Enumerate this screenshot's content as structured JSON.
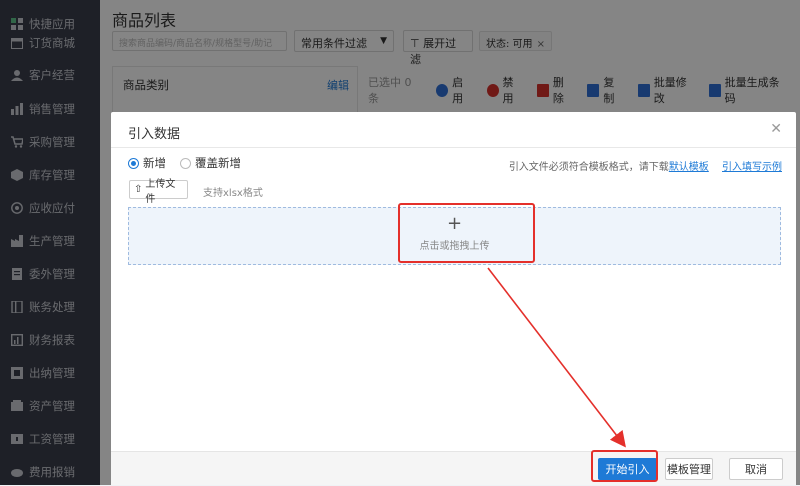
{
  "sidebar": {
    "items": [
      {
        "label": "快捷应用",
        "icon": "grid-icon"
      },
      {
        "label": "订货商城",
        "icon": "calendar-icon"
      },
      {
        "label": "客户经营",
        "icon": "user-icon"
      },
      {
        "label": "销售管理",
        "icon": "chart-icon"
      },
      {
        "label": "采购管理",
        "icon": "cart-icon"
      },
      {
        "label": "库存管理",
        "icon": "box-icon"
      },
      {
        "label": "应收应付",
        "icon": "coin-icon"
      },
      {
        "label": "生产管理",
        "icon": "factory-icon"
      },
      {
        "label": "委外管理",
        "icon": "doc-icon"
      },
      {
        "label": "账务处理",
        "icon": "book-icon"
      },
      {
        "label": "财务报表",
        "icon": "report-icon"
      },
      {
        "label": "出纳管理",
        "icon": "cashier-icon"
      },
      {
        "label": "资产管理",
        "icon": "asset-icon"
      },
      {
        "label": "工资管理",
        "icon": "wage-icon"
      },
      {
        "label": "费用报销",
        "icon": "expense-icon"
      }
    ]
  },
  "page": {
    "title": "商品列表",
    "search_placeholder": "搜索商品编码/商品名称/规格型号/助记",
    "filter_select": "常用条件过滤",
    "expand_filter": "展开过滤",
    "status_tag": "状态: 可用",
    "category_title": "商品类别",
    "category_edit": "编辑",
    "selected_count": "已选中 0 条",
    "toolbar": {
      "enable": "启用",
      "disable": "禁用",
      "delete": "删除",
      "copy": "复制",
      "batch_edit": "批量修改",
      "batch_barcode": "批量生成条码"
    },
    "colors": {
      "enable": "#2f6fd6",
      "disable": "#d6302b",
      "delete": "#d6302b",
      "copy": "#2f6fd6",
      "batch_edit": "#2f6fd6",
      "batch_barcode": "#2f6fd6"
    }
  },
  "modal": {
    "title": "引入数据",
    "radio_new": "新增",
    "radio_overwrite": "覆盖新增",
    "selected_radio": "新增",
    "hint_text": "引入文件必须符合模板格式，请下载",
    "hint_link_template": "默认模板",
    "hint_link_example": "引入填写示例",
    "upload_button": "上传文件",
    "upload_hint": "支持xlsx格式",
    "dropzone_plus": "+",
    "dropzone_text": "点击或拖拽上传",
    "btn_start": "开始引入",
    "btn_template": "模板管理",
    "btn_cancel": "取消"
  },
  "annotation_color": "#e4302b"
}
